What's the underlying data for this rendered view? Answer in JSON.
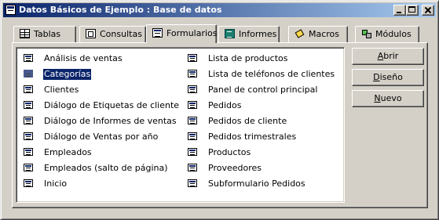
{
  "window": {
    "title": "Datos Básicos de Ejemplo : Base de datos"
  },
  "tabs": [
    {
      "label": "Tablas",
      "icon": "table-icon"
    },
    {
      "label": "Consultas",
      "icon": "query-icon"
    },
    {
      "label": "Formularios",
      "icon": "form-icon",
      "active": true
    },
    {
      "label": "Informes",
      "icon": "report-icon"
    },
    {
      "label": "Macros",
      "icon": "macro-icon"
    },
    {
      "label": "Módulos",
      "icon": "module-icon"
    }
  ],
  "list": {
    "column1": [
      {
        "label": "Análisis de ventas"
      },
      {
        "label": "Categorías",
        "selected": true
      },
      {
        "label": "Clientes"
      },
      {
        "label": "Diálogo de Etiquetas de cliente"
      },
      {
        "label": "Diálogo de Informes de ventas"
      },
      {
        "label": "Diálogo de Ventas por año"
      },
      {
        "label": "Empleados"
      },
      {
        "label": "Empleados (salto de página)"
      },
      {
        "label": "Inicio"
      }
    ],
    "column2": [
      {
        "label": "Lista de productos"
      },
      {
        "label": "Lista de teléfonos de clientes"
      },
      {
        "label": "Panel de control principal"
      },
      {
        "label": "Pedidos"
      },
      {
        "label": "Pedidos de cliente"
      },
      {
        "label": "Pedidos trimestrales"
      },
      {
        "label": "Productos"
      },
      {
        "label": "Proveedores"
      },
      {
        "label": "Subformulario Pedidos"
      }
    ]
  },
  "buttons": {
    "open": {
      "label": "Abrir",
      "mnemonic_char": "A",
      "rest": "brir"
    },
    "design": {
      "label": "Diseño",
      "mnemonic_char": "D",
      "rest": "iseño"
    },
    "new": {
      "label": "Nuevo",
      "mnemonic_char": "N",
      "rest": "uevo"
    }
  },
  "colors": {
    "title_active": "#0a246a",
    "face": "#d4d0c8",
    "selection": "#0a246a"
  }
}
